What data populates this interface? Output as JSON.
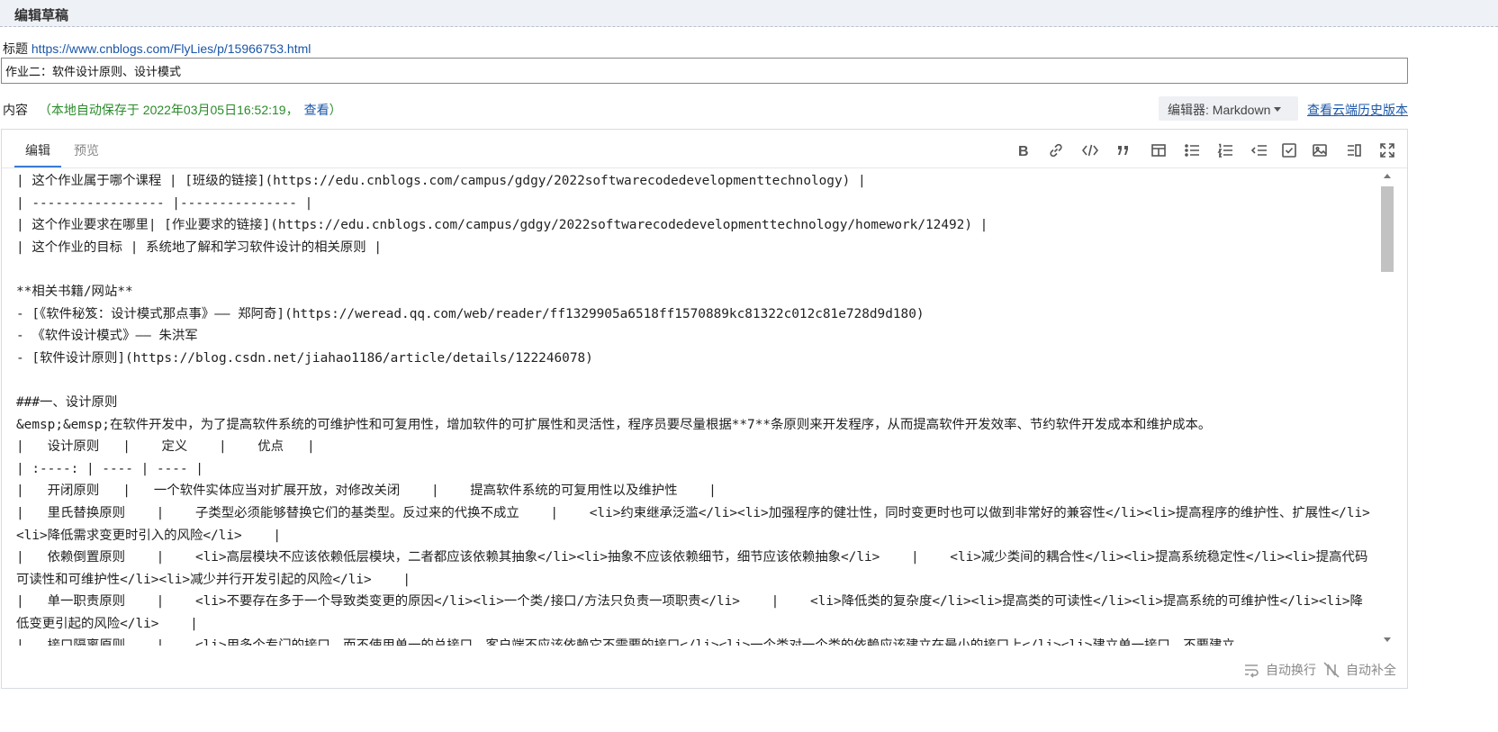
{
  "header": {
    "title": "编辑草稿"
  },
  "title_field": {
    "label": "标题",
    "link": "https://www.cnblogs.com/FlyLies/p/15966753.html",
    "value": "作业二：软件设计原则、设计模式"
  },
  "content_row": {
    "label": "内容",
    "autosave_text": "（本地自动保存于 2022年03月05日16:52:19，",
    "view_link": "查看",
    "autosave_close": "）",
    "editor_select": "编辑器: Markdown",
    "cloud_history": "查看云端历史版本"
  },
  "tabs": [
    {
      "label": "编辑",
      "active": true
    },
    {
      "label": "预览",
      "active": false
    }
  ],
  "toolbar": [
    {
      "name": "bold-icon",
      "label": "B"
    },
    {
      "name": "link-icon",
      "label": "link"
    },
    {
      "name": "code-icon",
      "label": "code"
    },
    {
      "name": "quote-icon",
      "label": "quote"
    },
    {
      "name": "table-icon",
      "label": "table"
    },
    {
      "name": "unordered-list-icon",
      "label": "ul"
    },
    {
      "name": "ordered-list-icon",
      "label": "ol"
    },
    {
      "name": "outdent-icon",
      "label": "outdent"
    },
    {
      "name": "task-list-icon",
      "label": "task"
    },
    {
      "name": "image-icon",
      "label": "image"
    },
    {
      "name": "side-by-side-icon",
      "label": "side"
    },
    {
      "name": "fullscreen-icon",
      "label": "fullscreen"
    }
  ],
  "editor_lines": [
    "| 这个作业属于哪个课程 | [班级的链接](https://edu.cnblogs.com/campus/gdgy/2022softwarecodedevelopmenttechnology) |",
    "| ----------------- |--------------- |",
    "| 这个作业要求在哪里| [作业要求的链接](https://edu.cnblogs.com/campus/gdgy/2022softwarecodedevelopmenttechnology/homework/12492) |",
    "| 这个作业的目标 | 系统地了解和学习软件设计的相关原则 |",
    "",
    "**相关书籍/网站**",
    "- [《软件秘笈：设计模式那点事》—— 郑阿奇](https://weread.qq.com/web/reader/ff1329905a6518ff1570889kc81322c012c81e728d9d180)",
    "- 《软件设计模式》—— 朱洪军",
    "- [软件设计原则](https://blog.csdn.net/jiahao1186/article/details/122246078)",
    "",
    "###一、设计原则",
    "&emsp;&emsp;在软件开发中，为了提高软件系统的可维护性和可复用性，增加软件的可扩展性和灵活性，程序员要尽量根据**7**条原则来开发程序，从而提高软件开发效率、节约软件开发成本和维护成本。",
    "|   设计原则   |    定义    |    优点   |",
    "| :----: | ---- | ---- |",
    "|   开闭原则   |   一个软件实体应当对扩展开放，对修改关闭    |    提高软件系统的可复用性以及维护性    |",
    "|   里氏替换原则    |    子类型必须能够替换它们的基类型。反过来的代换不成立    |    <li>约束继承泛滥</li><li>加强程序的健壮性，同时变更时也可以做到非常好的兼容性</li><li>提高程序的维护性、扩展性</li><li>降低需求变更时引入的风险</li>    |",
    "|   依赖倒置原则    |    <li>高层模块不应该依赖低层模块，二者都应该依赖其抽象</li><li>抽象不应该依赖细节，细节应该依赖抽象</li>    |    <li>减少类间的耦合性</li><li>提高系统稳定性</li><li>提高代码可读性和可维护性</li><li>减少并行开发引起的风险</li>    |",
    "|   单一职责原则    |    <li>不要存在多于一个导致类变更的原因</li><li>一个类/接口/方法只负责一项职责</li>    |    <li>降低类的复杂度</li><li>提高类的可读性</li><li>提高系统的可维护性</li><li>降低变更引起的风险</li>    |",
    "|   接口隔离原则    |    <li>用多个专门的接口，而不使用单一的总接口，客户端不应该依赖它不需要的接口</li><li>一个类对一个类的依赖应该建立在最小的接口上</li><li>建立单一接口，不要建立"
  ],
  "footer": {
    "wrap_label": "自动换行",
    "complete_label": "自动补全"
  }
}
